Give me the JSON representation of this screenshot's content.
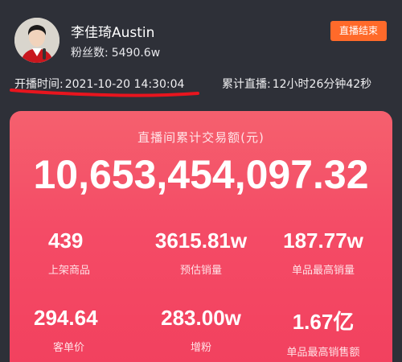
{
  "streamer": {
    "name": "李佳琦Austin",
    "fans_label": "粉丝数:",
    "fans_value": "5490.6w"
  },
  "end_button": "直播结束",
  "session": {
    "start_label": "开播时间:",
    "start_value": "2021-10-20 14:30:04",
    "duration_label": "累计直播:",
    "duration_value": "12小时26分钟42秒"
  },
  "summary": {
    "title": "直播间累计交易额(元)",
    "total_amount": "10,653,454,097.32"
  },
  "stats": [
    {
      "value": "439",
      "label": "上架商品"
    },
    {
      "value": "3615.81w",
      "label": "预估销量"
    },
    {
      "value": "187.77w",
      "label": "单品最高销量"
    },
    {
      "value": "294.64",
      "label": "客单价"
    },
    {
      "value": "283.00w",
      "label": "增粉"
    },
    {
      "value": "1.67亿",
      "label": "单品最高销售额"
    }
  ],
  "colors": {
    "background": "#2e3038",
    "end_button": "#ff6a2a",
    "card_gradient_top": "#f5606e",
    "card_gradient_bottom": "#f2405e",
    "annotation_line": "#e8151e"
  }
}
